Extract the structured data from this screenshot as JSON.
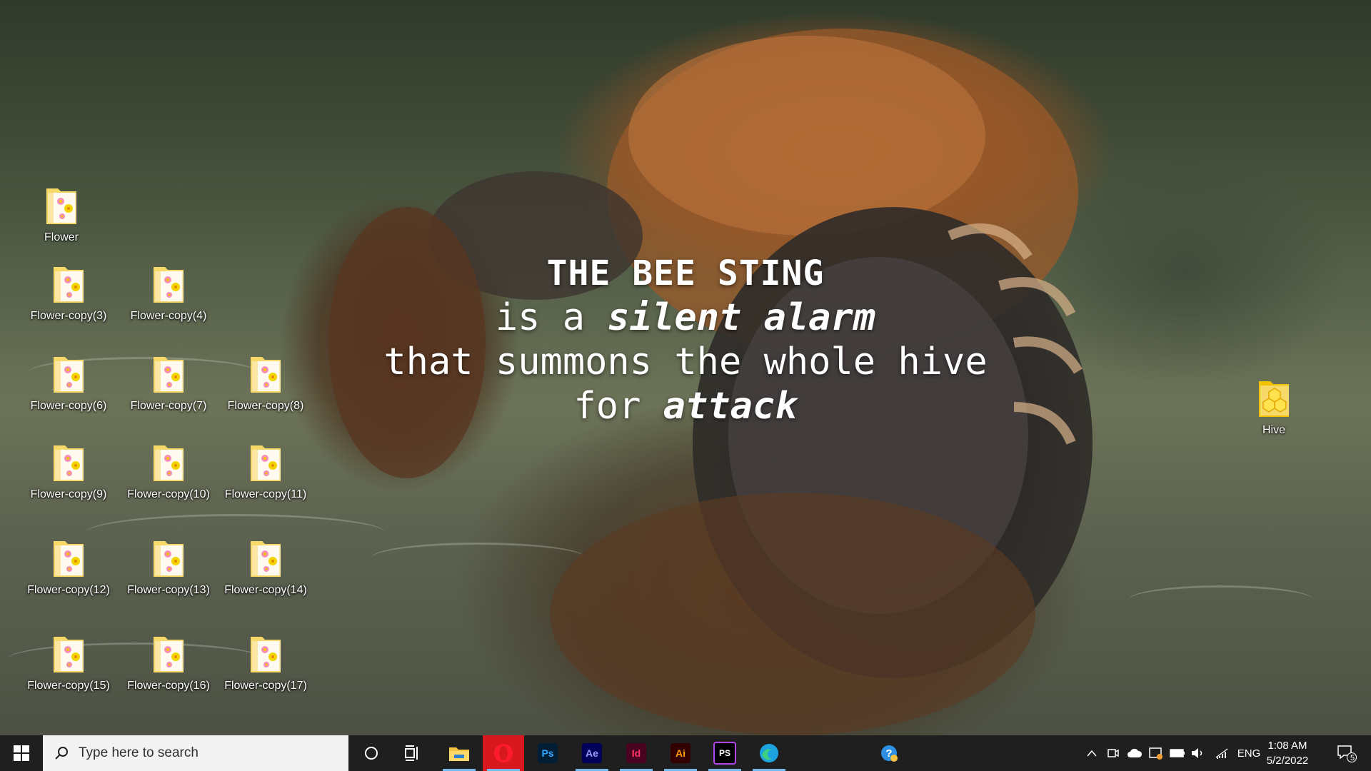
{
  "wallpaper": {
    "quote": {
      "line1": "THE BEE STING",
      "line2_prefix": "is a ",
      "line2_emphasis": "silent alarm",
      "line3": "that summons the whole hive",
      "line4_prefix": "for ",
      "line4_emphasis": "attack"
    }
  },
  "desktop": {
    "icons": [
      {
        "label": "Flower"
      },
      {
        "label": "Flower-copy(3)"
      },
      {
        "label": "Flower-copy(4)"
      },
      {
        "label": "Flower-copy(6)"
      },
      {
        "label": "Flower-copy(7)"
      },
      {
        "label": "Flower-copy(8)"
      },
      {
        "label": "Flower-copy(9)"
      },
      {
        "label": "Flower-copy(10)"
      },
      {
        "label": "Flower-copy(11)"
      },
      {
        "label": "Flower-copy(12)"
      },
      {
        "label": "Flower-copy(13)"
      },
      {
        "label": "Flower-copy(14)"
      },
      {
        "label": "Flower-copy(15)"
      },
      {
        "label": "Flower-copy(16)"
      },
      {
        "label": "Flower-copy(17)"
      },
      {
        "label": "Hive"
      }
    ]
  },
  "taskbar": {
    "search_placeholder": "Type here to search",
    "apps": [
      {
        "name": "File Explorer",
        "icon": "folder-icon"
      },
      {
        "name": "Opera",
        "icon": "opera-icon"
      },
      {
        "name": "Photoshop",
        "tile_text": "Ps",
        "color": "#31a8ff",
        "bg": "#001e36"
      },
      {
        "name": "After Effects",
        "tile_text": "Ae",
        "color": "#9999ff",
        "bg": "#00005b"
      },
      {
        "name": "InDesign",
        "tile_text": "Id",
        "color": "#ff3366",
        "bg": "#49021f"
      },
      {
        "name": "Illustrator",
        "tile_text": "Ai",
        "color": "#ff9a00",
        "bg": "#330000"
      },
      {
        "name": "PhpStorm",
        "tile_text": "PS",
        "color": "#ffffff",
        "bg": "#000000"
      },
      {
        "name": "Edge",
        "icon": "edge-icon"
      }
    ],
    "tray": {
      "language": "ENG",
      "time": "1:08 AM",
      "date": "5/2/2022",
      "notification_count": "5"
    }
  },
  "colors": {
    "taskbar_bg": "#1f1f1f",
    "active_underline": "#76b9ed",
    "folder_yellow": "#f7d96a"
  }
}
